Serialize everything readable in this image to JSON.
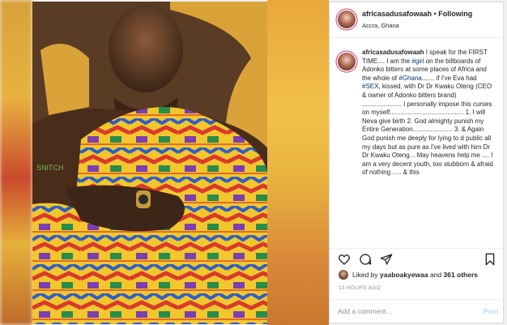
{
  "header": {
    "username": "africasadusafowaah",
    "separator": "•",
    "follow_label": "Following",
    "location": "Accra, Ghana"
  },
  "caption": {
    "username": "africasadusafowaah",
    "segments": [
      {
        "t": "I speak for the FIRST TIME.... I am the "
      },
      {
        "t": "#girl",
        "tag": true
      },
      {
        "t": " on the billboards of Adonko bitters at some places of Africa and the whole of "
      },
      {
        "t": "#Ghana",
        "tag": true
      },
      {
        "t": "....... if I've Eva had "
      },
      {
        "t": "#SEX",
        "tag": true
      },
      {
        "t": ", kissed, with Dr Dr Kwaku Oteng (CEO & owner of Adonko bitters brand) ...................... I personally impose this curses on myself......................................... 1. I will Neva give birth 2. God almighty punish my Entire Generation...................... 3. & Again God punish me deeply for lying to d public all my days but as pure as I've lived with him Dr Dr Kwaku Oteng... May heavens help me .... I am a very decent youth, too stubborn & afraid of nothing ..... & this"
      }
    ]
  },
  "actions": {
    "like_icon": "heart-icon",
    "comment_icon": "comment-icon",
    "share_icon": "share-icon",
    "save_icon": "bookmark-icon"
  },
  "likes": {
    "prefix": "Liked by ",
    "user": "yaaboakyewaa",
    "middle": " and ",
    "count": "361 others"
  },
  "timestamp": "13 HOURS AGO",
  "comment": {
    "placeholder": "Add a comment...",
    "post_label": "Post"
  },
  "watermark": "SNITCH",
  "colors": {
    "link": "#00376b",
    "story_ring": "#e1306c",
    "post_disabled": "#b2dffc",
    "muted": "#8e8e8e"
  }
}
